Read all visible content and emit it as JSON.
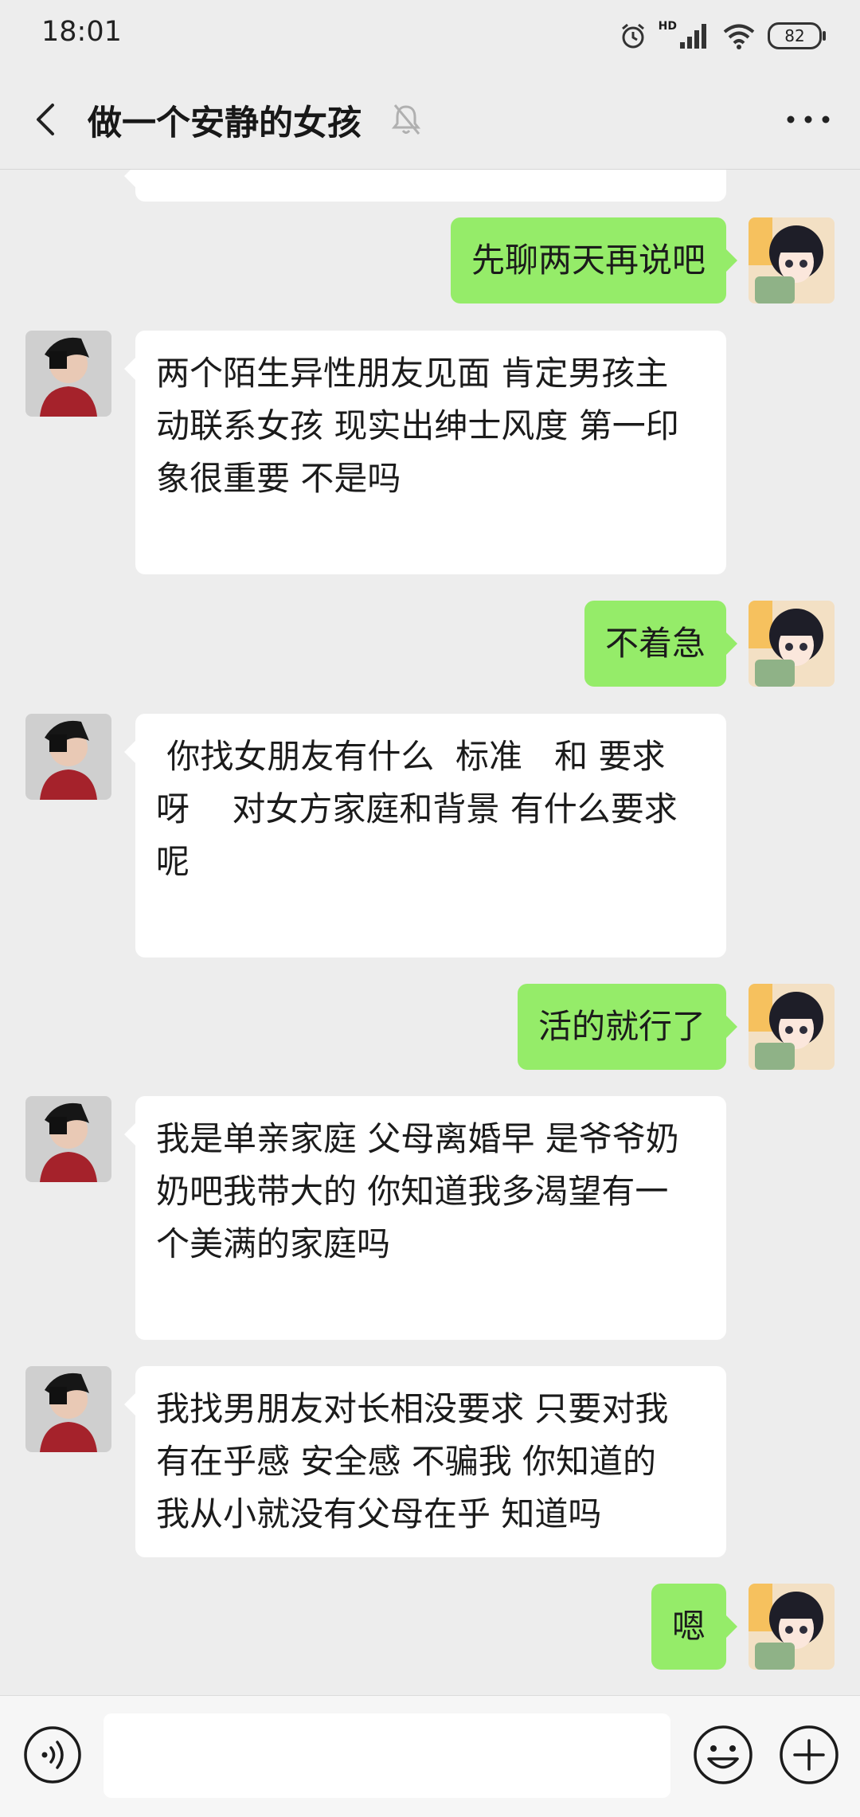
{
  "status": {
    "time": "18:01",
    "network": "HD",
    "battery": "82"
  },
  "header": {
    "title": "做一个安静的女孩"
  },
  "messages": [
    {
      "side": "out",
      "lines": [
        "先聊两天再说吧"
      ]
    },
    {
      "side": "in",
      "lines": [
        "",
        "两个陌生异性朋友见面 肯定男孩主",
        "动联系女孩 现实出绅士风度 第一印",
        "象很重要 不是吗"
      ]
    },
    {
      "side": "out",
      "lines": [
        "不着急"
      ]
    },
    {
      "side": "in",
      "lines": [
        "",
        " 你找女朋友有什么  标准   和 要求",
        "呀    对女方家庭和背景 有什么要求",
        "呢"
      ]
    },
    {
      "side": "out",
      "lines": [
        "活的就行了"
      ]
    },
    {
      "side": "in",
      "lines": [
        "",
        "我是单亲家庭 父母离婚早 是爷爷奶",
        "奶吧我带大的 你知道我多渴望有一",
        "个美满的家庭吗"
      ]
    },
    {
      "side": "in",
      "lines": [
        "我找男朋友对长相没要求 只要对我",
        "有在乎感 安全感 不骗我 你知道的",
        "我从小就没有父母在乎 知道吗"
      ]
    },
    {
      "side": "out",
      "lines": [
        "嗯"
      ]
    }
  ],
  "input": {
    "placeholder": ""
  },
  "colors": {
    "background": "#ededed",
    "outgoing_bubble": "#95ec69",
    "incoming_bubble": "#ffffff"
  }
}
